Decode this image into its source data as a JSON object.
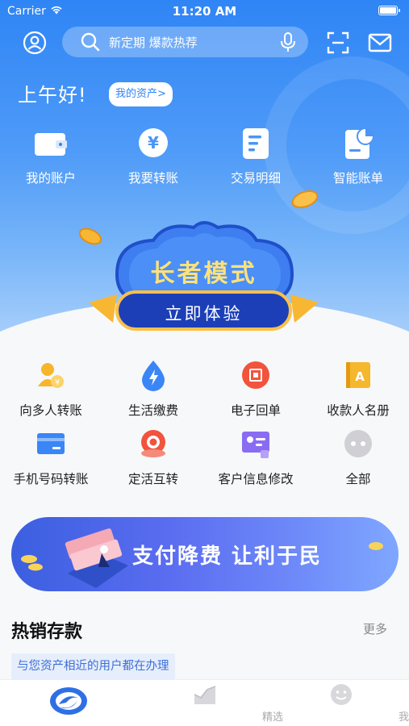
{
  "status": {
    "carrier": "Carrier",
    "time": "11:20 AM"
  },
  "header": {
    "search_placeholder": "新定期 爆款热荐"
  },
  "greeting": {
    "text": "上午好!",
    "assets_link": "我的资产>"
  },
  "quick_actions": [
    {
      "label": "我的账户",
      "icon": "wallet-icon"
    },
    {
      "label": "我要转账",
      "icon": "yuan-transfer-icon"
    },
    {
      "label": "交易明细",
      "icon": "document-list-icon"
    },
    {
      "label": "智能账单",
      "icon": "pie-bill-icon"
    }
  ],
  "promo_banner": {
    "title": "长者模式",
    "button": "立即体验"
  },
  "services": [
    {
      "label": "向多人转账",
      "icon": "multi-user-transfer-icon",
      "color": "#f7b52c"
    },
    {
      "label": "生活缴费",
      "icon": "lightning-drop-icon",
      "color": "#3a86f7"
    },
    {
      "label": "电子回单",
      "icon": "receipt-icon",
      "color": "#f2533d"
    },
    {
      "label": "收款人名册",
      "icon": "payee-book-icon",
      "color": "#f5b72d"
    },
    {
      "label": "手机号码转账",
      "icon": "card-icon",
      "color": "#3a86f7"
    },
    {
      "label": "定活互转",
      "icon": "exchange-icon",
      "color": "#f2533d"
    },
    {
      "label": "客户信息修改",
      "icon": "profile-edit-icon",
      "color": "#8a6cf3"
    },
    {
      "label": "全部",
      "icon": "more-dots-icon",
      "color": "#cfcfd4"
    }
  ],
  "fee_banner": {
    "title": "支付降费 让利于民"
  },
  "hot_deposits": {
    "title": "热销存款",
    "more": "更多",
    "tag": "与您资产相近的用户都在办理"
  },
  "tabbar": [
    {
      "label": "",
      "icon": "home-logo-icon"
    },
    {
      "label": "精选",
      "icon": "chart-trend-icon"
    },
    {
      "label": "我的",
      "icon": "smiley-icon"
    }
  ]
}
